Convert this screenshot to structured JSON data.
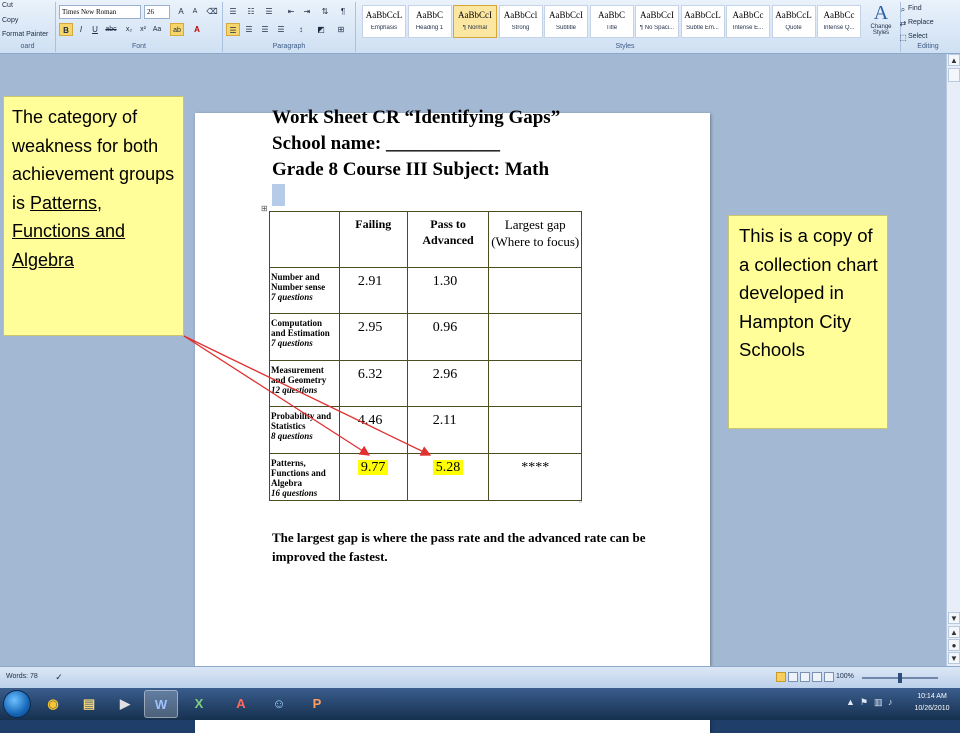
{
  "ribbon": {
    "clipboard": {
      "cut": "Cut",
      "copy": "Copy",
      "format_painter": "Format Painter",
      "group": "oard"
    },
    "font": {
      "name": "Times New Roman",
      "size": "26",
      "group": "Font"
    },
    "paragraph": {
      "group": "Paragraph"
    },
    "styles": {
      "group": "Styles",
      "items": [
        {
          "sample": "AaBbCcL",
          "name": "Emphasis"
        },
        {
          "sample": "AaBbC",
          "name": "Heading 1"
        },
        {
          "sample": "AaBbCcI",
          "name": "¶ Normal"
        },
        {
          "sample": "AaBbCcl",
          "name": "Strong"
        },
        {
          "sample": "AaBbCcI",
          "name": "Subtitle"
        },
        {
          "sample": "AaBbC",
          "name": "Title"
        },
        {
          "sample": "AaBbCcI",
          "name": "¶ No Spaci..."
        },
        {
          "sample": "AaBbCcL",
          "name": "Subtle Em..."
        },
        {
          "sample": "AaBbCc",
          "name": "Intense E..."
        },
        {
          "sample": "AaBbCcL",
          "name": "Quote"
        },
        {
          "sample": "AaBbCc",
          "name": "Intense Q..."
        }
      ],
      "change_styles": "Change Styles"
    },
    "editing": {
      "find": "Find",
      "replace": "Replace",
      "select": "Select",
      "group": "Editing"
    }
  },
  "worksheet": {
    "title_line1": "Work Sheet CR     “Identifying Gaps”",
    "title_line2": "School name:   ____________",
    "title_line3": "Grade 8 Course III   Subject: Math",
    "table": {
      "headers": [
        "",
        "Failing",
        "Pass to Advanced",
        "Largest gap (Where to focus)"
      ],
      "rows": [
        {
          "label": "Number and Number sense",
          "questions": "7 questions",
          "failing": "2.91",
          "pass": "1.30",
          "gap": ""
        },
        {
          "label": "Computation and Estimation",
          "questions": "7 questions",
          "failing": "2.95",
          "pass": "0.96",
          "gap": ""
        },
        {
          "label": "Measurement and Geometry",
          "questions": "12 questions",
          "failing": "6.32",
          "pass": "2.96",
          "gap": ""
        },
        {
          "label": "Probability and Statistics",
          "questions": "8  questions",
          "failing": "4.46",
          "pass": "2.11",
          "gap": ""
        },
        {
          "label": "Patterns, Functions and Algebra",
          "questions": "16  questions",
          "failing": "9.77",
          "pass": "5.28",
          "gap": "****"
        }
      ]
    },
    "footer": "The largest gap is where the pass rate and the advanced rate can be improved the fastest."
  },
  "callouts": {
    "left_plain": "The category of weakness for both achievement groups is",
    "left_underlined": "Patterns, Functions and Algebra",
    "right": "This is a copy of a collection chart developed in Hampton City Schools"
  },
  "status": {
    "words": "Words: 78",
    "zoom": "100%"
  },
  "taskbar": {
    "time": "10:14 AM",
    "date": "10/26/2010"
  },
  "colors": {
    "callout_bg": "#fffe99",
    "highlight": "#ffff00",
    "arrow": "#e03030"
  }
}
